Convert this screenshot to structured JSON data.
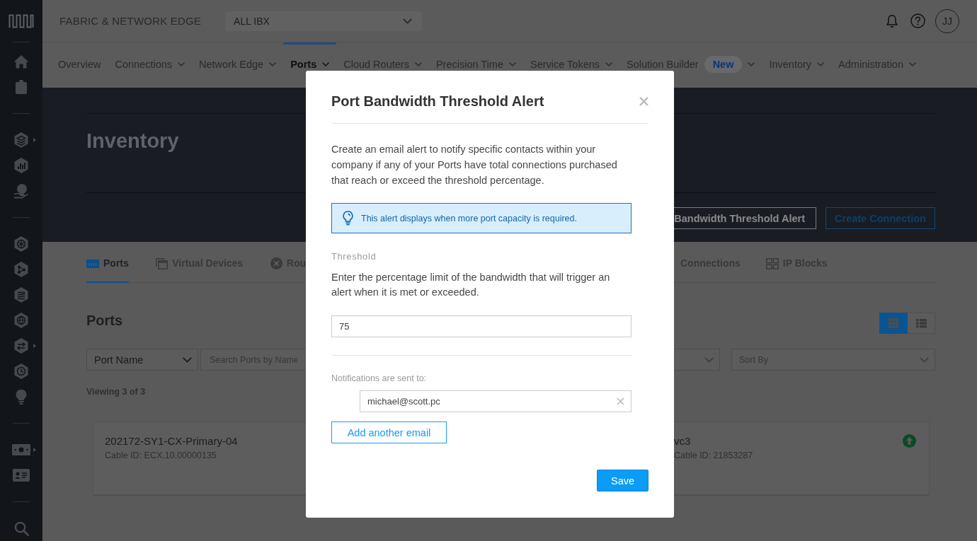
{
  "sidebar": {
    "groups": [
      {
        "items": [
          {
            "kind": "home",
            "submenu": false
          },
          {
            "kind": "clipboard",
            "submenu": false
          }
        ]
      },
      {
        "items": [
          {
            "kind": "layers",
            "submenu": true
          },
          {
            "kind": "chart",
            "submenu": false
          },
          {
            "kind": "handglobe",
            "submenu": false
          }
        ]
      },
      {
        "items": [
          {
            "kind": "network",
            "submenu": false
          },
          {
            "kind": "nodes",
            "submenu": false
          },
          {
            "kind": "stack",
            "submenu": false
          },
          {
            "kind": "globe",
            "submenu": false
          },
          {
            "kind": "exchange",
            "submenu": true
          },
          {
            "kind": "clock",
            "submenu": false
          },
          {
            "kind": "bulb",
            "submenu": false
          }
        ]
      },
      {
        "items": [
          {
            "kind": "money",
            "submenu": true
          },
          {
            "kind": "idcard",
            "submenu": false
          }
        ]
      },
      {
        "items": [
          {
            "kind": "search",
            "submenu": false
          }
        ]
      }
    ]
  },
  "header": {
    "app_title": "FABRIC & NETWORK EDGE",
    "location_select": {
      "value": "ALL IBX"
    },
    "avatar": {
      "initials": "JJ"
    }
  },
  "nav": {
    "items": [
      {
        "label": "Overview",
        "dropdown": false,
        "selected": false
      },
      {
        "label": "Connections",
        "dropdown": true,
        "selected": false
      },
      {
        "label": "Network Edge",
        "dropdown": true,
        "selected": false
      },
      {
        "label": "Ports",
        "dropdown": true,
        "selected": true
      },
      {
        "label": "Cloud Routers",
        "dropdown": true,
        "selected": false
      },
      {
        "label": "Precision Time",
        "dropdown": true,
        "selected": false
      },
      {
        "label": "Service Tokens",
        "dropdown": true,
        "selected": false
      },
      {
        "label": "Solution Builder",
        "badge": "New",
        "dropdown": true,
        "selected": false
      },
      {
        "label": "Inventory",
        "dropdown": true,
        "selected": false
      },
      {
        "label": "Administration",
        "dropdown": true,
        "selected": false
      }
    ]
  },
  "page": {
    "title": "Inventory",
    "actions": [
      {
        "label": "Bandwidth Threshold Alert",
        "kind": "secondary"
      },
      {
        "label": "Create Connection",
        "kind": "primary"
      }
    ],
    "tabs": [
      {
        "label": "Ports",
        "kind": "ports",
        "selected": true
      },
      {
        "label": "Virtual Devices",
        "kind": "devices",
        "selected": false
      },
      {
        "label": "Rou",
        "kind": "routers",
        "selected": false
      },
      {
        "label": "Connections",
        "kind": "plain",
        "selected": false
      },
      {
        "label": "IP Blocks",
        "kind": "blocks",
        "selected": false
      }
    ],
    "section_title": "Ports",
    "view_toggle": [
      {
        "kind": "grid",
        "selected": true
      },
      {
        "kind": "list",
        "selected": false
      }
    ],
    "filters": [
      {
        "kind": "select",
        "value": "Port Name"
      },
      {
        "kind": "search",
        "placeholder": "Search Ports by Name"
      },
      {
        "kind": "select"
      },
      {
        "kind": "select",
        "placeholder": "Sort By"
      }
    ],
    "result_count": "Viewing 3 of 3",
    "cards": [
      {
        "title": "202172-SY1-CX-Primary-04",
        "cable_id": "Cable ID: ECX.10.00000135"
      },
      {
        "title": "vc3",
        "cable_id": "Cable ID: 21853287",
        "online": true
      }
    ]
  },
  "modal": {
    "title": "Port Bandwidth Threshold Alert",
    "description": "Create an email alert to notify specific contacts within your company if any of your Ports have total connections purchased that reach or exceed the threshold percentage.",
    "info": "This alert displays when more port capacity is required.",
    "threshold": {
      "label": "Threshold",
      "help": "Enter the percentage limit of the bandwidth that will trigger an alert when it is met or exceeded.",
      "value": "75"
    },
    "notifications": {
      "label": "Notifications are sent to:",
      "emails": [
        "michael@scott.pc"
      ],
      "add_button": "Add another email"
    },
    "save_button": "Save"
  }
}
